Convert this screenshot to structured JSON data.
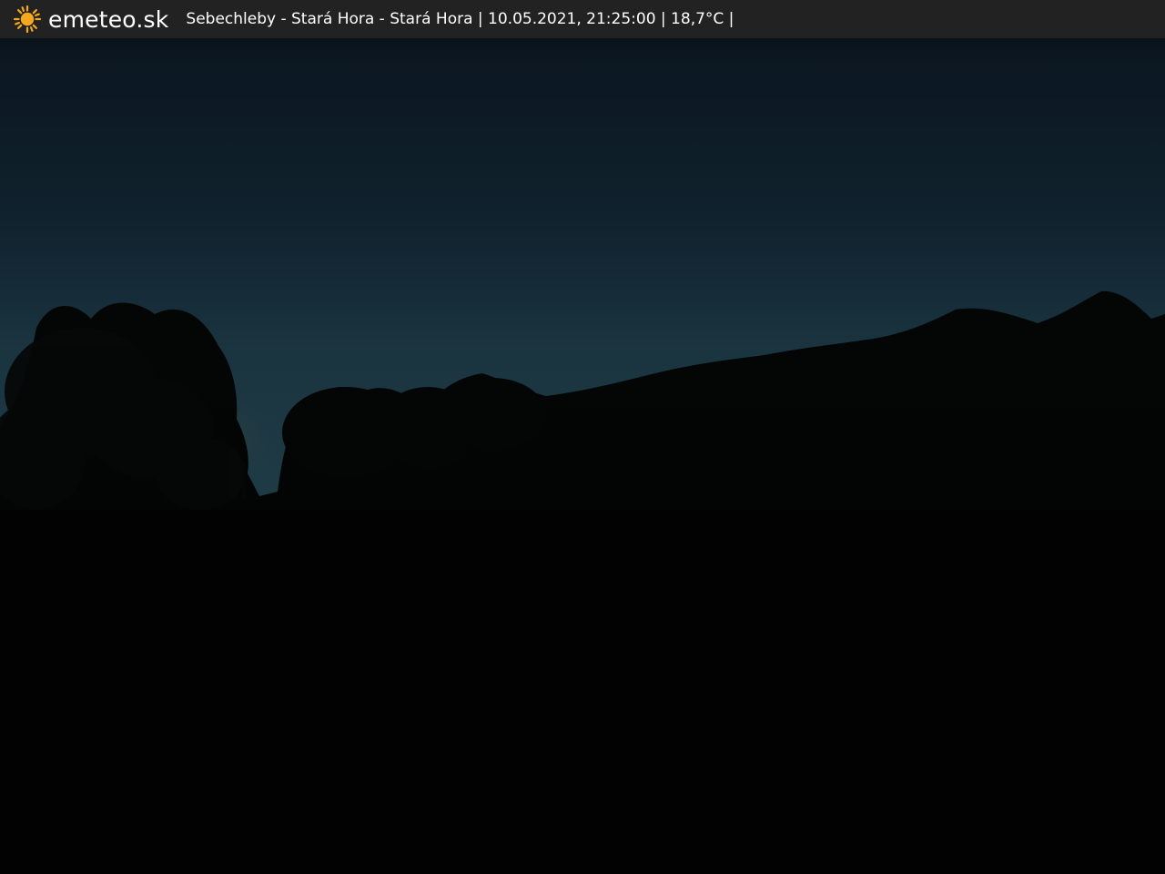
{
  "header": {
    "brand": "emeteo.sk",
    "caption": "Sebechleby - Stará Hora - Stará Hora | 10.05.2021, 21:25:00 | 18,7°C |"
  },
  "icons": {
    "logo": "sun-icon"
  },
  "colors": {
    "header_bg": "#222222",
    "sun": "#f5a81c",
    "sky_top": "#0c1722",
    "sky_horizon": "#1e3b48",
    "twilight_glow": "#5a5a44",
    "ground": "#020202"
  }
}
